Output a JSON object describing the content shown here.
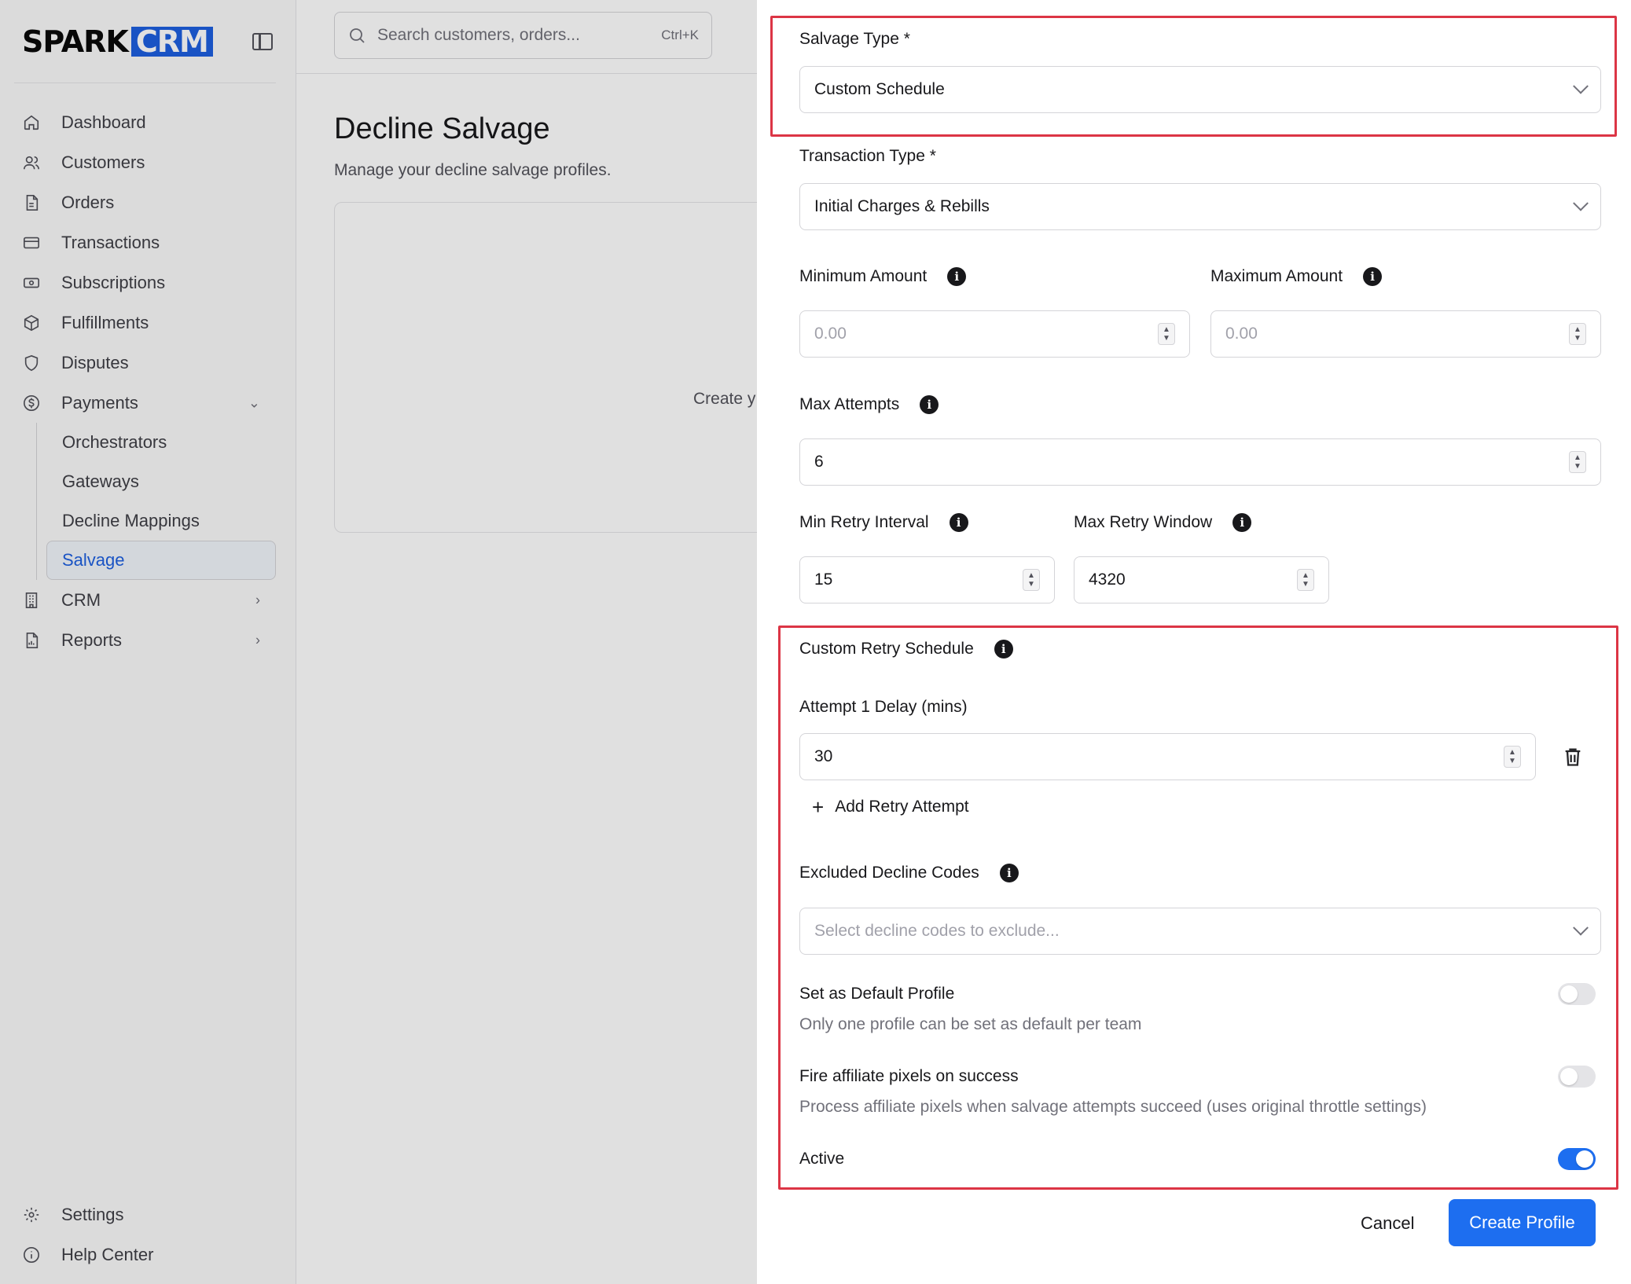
{
  "brand": {
    "name_part1": "SPARK",
    "name_part2": "CRM"
  },
  "sidebar": {
    "items": [
      {
        "label": "Dashboard",
        "icon": "home-icon"
      },
      {
        "label": "Customers",
        "icon": "users-icon"
      },
      {
        "label": "Orders",
        "icon": "file-icon"
      },
      {
        "label": "Transactions",
        "icon": "credit-card-icon"
      },
      {
        "label": "Subscriptions",
        "icon": "banknote-icon"
      },
      {
        "label": "Fulfillments",
        "icon": "package-icon"
      },
      {
        "label": "Disputes",
        "icon": "shield-icon"
      },
      {
        "label": "Payments",
        "icon": "dollar-circle-icon"
      }
    ],
    "payments_sub": [
      {
        "label": "Orchestrators"
      },
      {
        "label": "Gateways"
      },
      {
        "label": "Decline Mappings"
      },
      {
        "label": "Salvage",
        "active": true
      }
    ],
    "more": [
      {
        "label": "CRM",
        "icon": "building-icon"
      },
      {
        "label": "Reports",
        "icon": "report-icon"
      }
    ],
    "bottom": [
      {
        "label": "Settings",
        "icon": "gear-icon"
      },
      {
        "label": "Help Center",
        "icon": "info-circle-icon"
      }
    ]
  },
  "search": {
    "placeholder": "Search customers, orders...",
    "shortcut": "Ctrl+K"
  },
  "page": {
    "title": "Decline Salvage",
    "subtitle": "Manage your decline salvage profiles.",
    "empty_text": "Create y"
  },
  "form": {
    "salvage_type": {
      "label": "Salvage Type *",
      "value": "Custom Schedule"
    },
    "transaction_type": {
      "label": "Transaction Type *",
      "value": "Initial Charges & Rebills"
    },
    "min_amount": {
      "label": "Minimum Amount",
      "placeholder": "0.00"
    },
    "max_amount": {
      "label": "Maximum Amount",
      "placeholder": "0.00"
    },
    "max_attempts": {
      "label": "Max Attempts",
      "value": "6"
    },
    "min_retry_interval": {
      "label": "Min Retry Interval",
      "value": "15"
    },
    "max_retry_window": {
      "label": "Max Retry Window",
      "value": "4320"
    },
    "custom_retry_schedule": {
      "label": "Custom Retry Schedule"
    },
    "attempt1": {
      "label": "Attempt 1 Delay (mins)",
      "value": "30"
    },
    "add_retry_label": "Add Retry Attempt",
    "excluded_codes": {
      "label": "Excluded Decline Codes",
      "placeholder": "Select decline codes to exclude..."
    },
    "default_profile": {
      "label": "Set as Default Profile",
      "desc": "Only one profile can be set as default per team",
      "on": false
    },
    "fire_pixels": {
      "label": "Fire affiliate pixels on success",
      "desc": "Process affiliate pixels when salvage attempts succeed (uses original throttle settings)",
      "on": false
    },
    "active": {
      "label": "Active",
      "on": true
    },
    "cancel_label": "Cancel",
    "create_label": "Create Profile"
  },
  "colors": {
    "accent": "#1d6ef0",
    "brand_blue": "#1d5fe0",
    "highlight_red": "#dc3545"
  }
}
